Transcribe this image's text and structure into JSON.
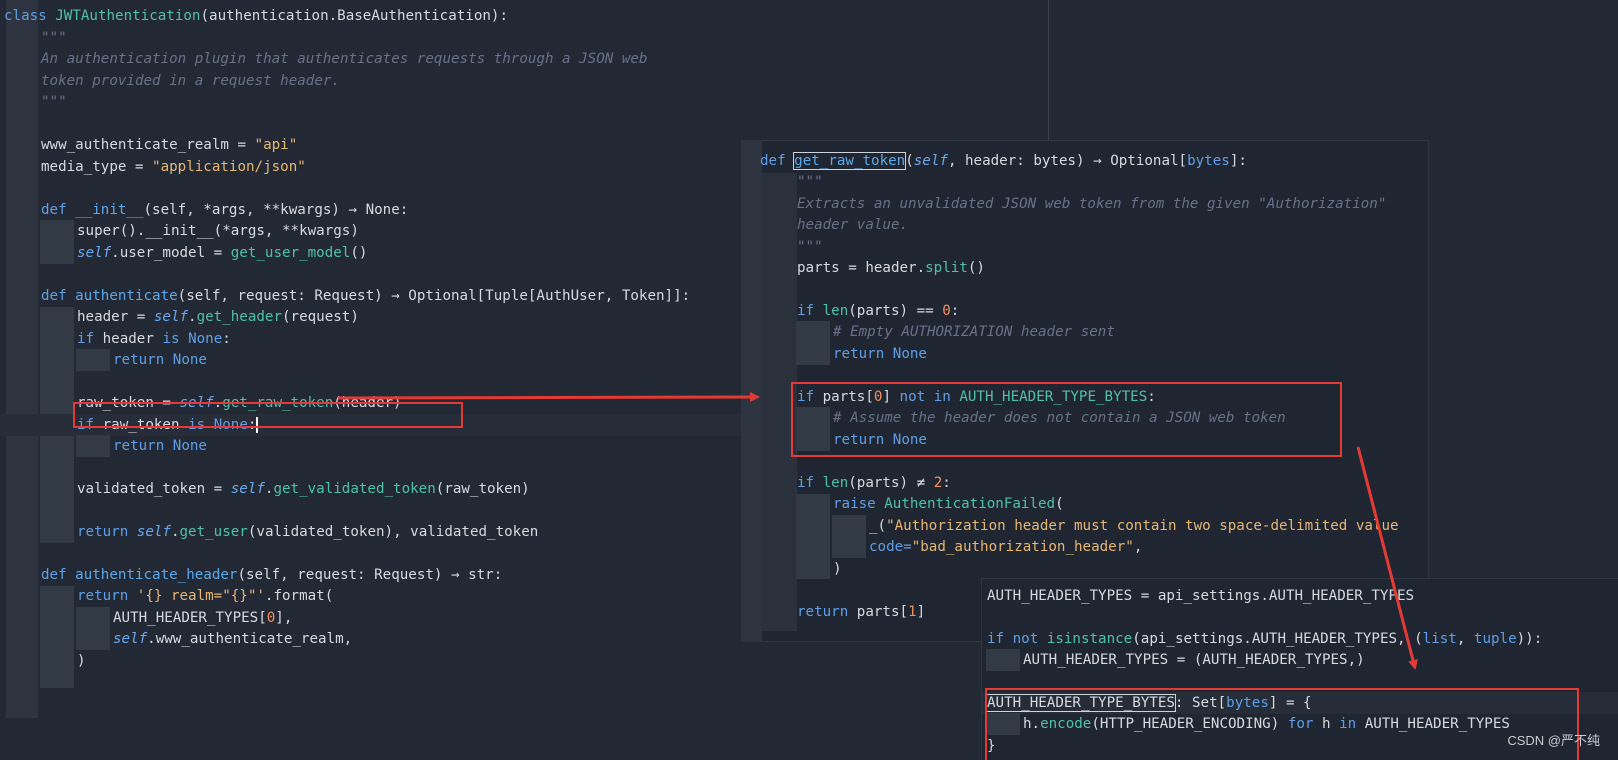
{
  "main": {
    "class_name": "JWTAuthentication",
    "base_class": "authentication.BaseAuthentication",
    "docstring_quotes": "\"\"\"",
    "docstring_1": "An authentication plugin that authenticates requests through a JSON web",
    "docstring_2": "token provided in a request header.",
    "realm_name": "www_authenticate_realm",
    "realm_value": "\"api\"",
    "media_name": "media_type",
    "media_value": "\"application/json\"",
    "init_name": "__init__",
    "init_sig": "(self, *args, **kwargs) → None:",
    "super_call": "super().__init__(*args, **kwargs)",
    "user_model_attr": ".user_model = ",
    "user_model_call": "get_user_model",
    "auth_name": "authenticate",
    "auth_sig": "(self, request: Request) → Optional[Tuple[AuthUser, Token]]:",
    "header_assign": "header = ",
    "get_header_call": "get_header",
    "request_arg": "(request)",
    "raw_token_var": "raw_token = ",
    "get_raw_token_call": "get_raw_token",
    "header_arg": "(header)",
    "raw_token_name": "raw_token",
    "validated_assign": "validated_token = ",
    "get_validated_call": "get_validated_token",
    "validated_arg": "(raw_token)",
    "get_user_call": "get_user",
    "return_tail": "(validated_token), validated_token",
    "auth_header_name": "authenticate_header",
    "auth_header_sig": "(self, request: Request) → str:",
    "format_str": "'{} realm=\"{}\"'",
    "format_call": ".format(",
    "types_index": "AUTH_HEADER_TYPES[",
    "index_zero": "0",
    "realm_attr": ".www_authenticate_realm,",
    "close_paren": ")"
  },
  "mid": {
    "def_name": "get_raw_token",
    "sig_pre": "(",
    "sig_mid": ", header: bytes) → Optional[",
    "sig_type": "bytes",
    "sig_end": "]:",
    "docstring_quotes": "\"\"\"",
    "docstring_1": "Extracts an unvalidated JSON web token from the given \"Authorization\"",
    "docstring_2": "header value.",
    "parts_assign": "parts = header.",
    "split_call": "split",
    "split_parens": "()",
    "len_call": "len",
    "parts_arg": "(parts)",
    "eq_op": " == ",
    "zero": "0",
    "colon": ":",
    "comment_1": "# Empty AUTHORIZATION header sent",
    "parts_index": "parts[",
    "not_in": " not in ",
    "const_bytes": "AUTH_HEADER_TYPE_BYTES",
    "comment_2": "# Assume the header does not contain a JSON web token",
    "ne_op": " ≠ ",
    "two": "2",
    "raise_cls": "AuthenticationFailed",
    "open_paren": "(",
    "msg_prefix": "_(",
    "msg": "\"Authorization header must contain two space-delimited value",
    "code_kw": "code=",
    "code_val": "\"bad_authorization_header\"",
    "comma": ",",
    "close_paren": ")",
    "return_parts": "parts[",
    "one": "1",
    "close_bracket": "]"
  },
  "right": {
    "line_1": "AUTH_HEADER_TYPES = api_settings.AUTH_HEADER_TYPES",
    "isinstance_call": "isinstance",
    "isinstance_args": "(api_settings.AUTH_HEADER_TYPES, (",
    "list_kw": "list",
    "tuple_kw": "tuple",
    "isinstance_end": ")):",
    "line_3": "AUTH_HEADER_TYPES = (AUTH_HEADER_TYPES,)",
    "bytes_name": "AUTH_HEADER_TYPE_BYTES",
    "bytes_annot": ": Set[",
    "bytes_type": "bytes",
    "bytes_end": "] = {",
    "h_var": "h.",
    "encode_call": "encode",
    "encode_args": "(HTTP_HEADER_ENCODING) ",
    "in_tail": " AUTH_HEADER_TYPES",
    "brace_close": "}"
  },
  "keywords": {
    "class": "class",
    "def": "def",
    "if": "if",
    "is": "is",
    "none": "None",
    "return": "return",
    "self": "self",
    "raise": "raise",
    "not": "not",
    "for": "for",
    "in": "in"
  },
  "watermark": "CSDN @严不纯",
  "colors": {
    "background": "#232934",
    "keyword": "#5f9ee6",
    "function_call": "#4fc1a6",
    "string": "#e6b673",
    "number": "#f09060",
    "comment": "#66718a",
    "annotation_red": "#e33a35"
  }
}
